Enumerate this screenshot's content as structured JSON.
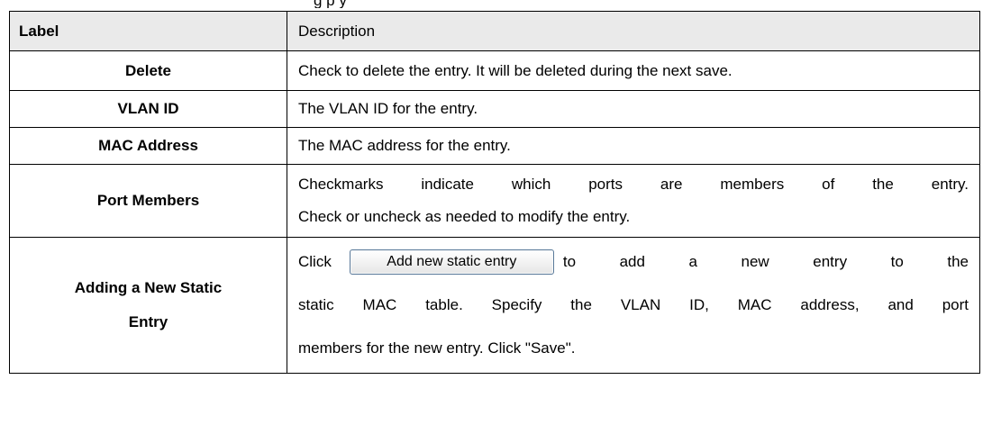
{
  "header": {
    "label": "Label",
    "description": "Description"
  },
  "rows": [
    {
      "label": "Delete",
      "description": "Check to delete the entry. It will be deleted during the next save."
    },
    {
      "label": "VLAN ID",
      "description": "The VLAN ID for the entry."
    },
    {
      "label": "MAC Address",
      "description": "The MAC address for the entry."
    },
    {
      "label": "Port Members",
      "description_lines": [
        "Checkmarks indicate which ports are members of the entry.",
        "Check or uncheck as needed to modify the entry."
      ]
    },
    {
      "label_lines": [
        "Adding a New Static",
        "Entry"
      ],
      "pre_button": "Click",
      "button_label": "Add new static entry",
      "post_button": "to add a new entry to the",
      "description_lines": [
        "static MAC table. Specify the VLAN ID, MAC address, and port",
        "members for the new entry. Click \"Save\"."
      ]
    }
  ]
}
